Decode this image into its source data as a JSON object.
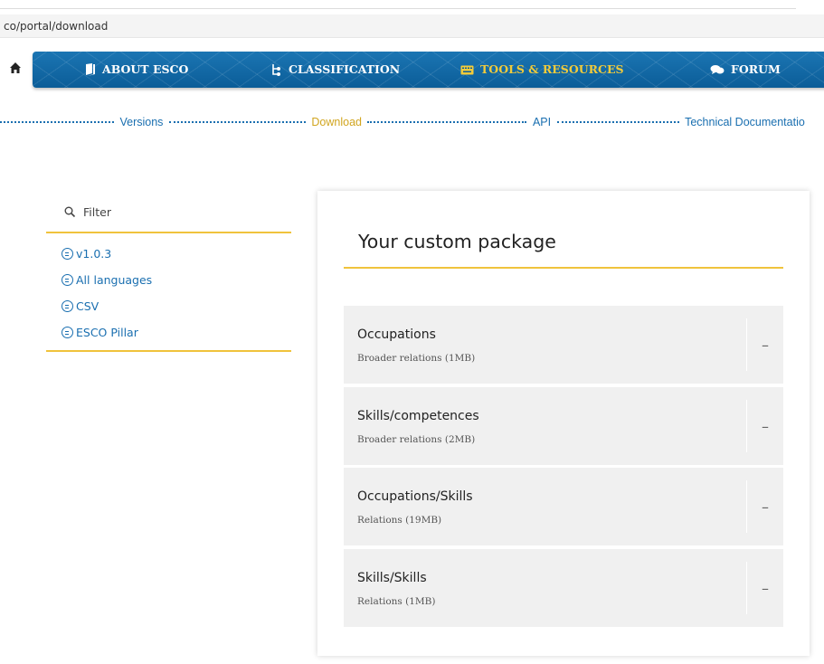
{
  "browser": {
    "url": "co/portal/download"
  },
  "nav": {
    "items": [
      {
        "label": "ABOUT ESCO",
        "icon": "book-icon",
        "active": false
      },
      {
        "label": "CLASSIFICATION",
        "icon": "hierarchy-icon",
        "active": false
      },
      {
        "label": "TOOLS & RESOURCES",
        "icon": "keyboard-icon",
        "active": true
      },
      {
        "label": "FORUM",
        "icon": "chat-icon",
        "active": false
      }
    ]
  },
  "subnav": {
    "items": [
      {
        "label": "Versions",
        "current": false
      },
      {
        "label": "Download",
        "current": true
      },
      {
        "label": "API",
        "current": false
      },
      {
        "label": "Technical Documentatio",
        "current": false
      }
    ]
  },
  "filter": {
    "placeholder": "Filter",
    "items": [
      "v1.0.3",
      "All languages",
      "CSV",
      "ESCO Pillar"
    ]
  },
  "package": {
    "title": "Your custom package",
    "items": [
      {
        "name": "Occupations",
        "detail": "Broader relations (1MB)",
        "action": "–"
      },
      {
        "name": "Skills/competences",
        "detail": "Broader relations (2MB)",
        "action": "–"
      },
      {
        "name": "Occupations/Skills",
        "detail": "Relations (19MB)",
        "action": "–"
      },
      {
        "name": "Skills/Skills",
        "detail": "Relations (1MB)",
        "action": "–"
      }
    ]
  },
  "colors": {
    "nav_blue": "#0b5d98",
    "accent_yellow": "#f0c33c",
    "link_blue": "#1a6fb0"
  }
}
